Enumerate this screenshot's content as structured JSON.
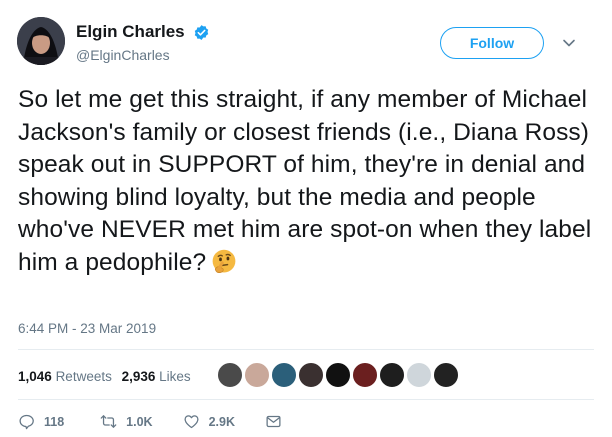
{
  "user": {
    "display_name": "Elgin Charles",
    "handle": "@ElginCharles",
    "verified": true
  },
  "follow_button": {
    "label": "Follow"
  },
  "tweet": {
    "text": "So let me get this straight, if any member of Michael Jackson's family or closest friends (i.e., Diana Ross) speak out in SUPPORT of him, they're in denial and showing blind loyalty, but the media and people who've NEVER met him are spot-on when they label him a pedophile?",
    "emoji": "thinking-face",
    "timestamp": "6:44 PM - 23 Mar 2019"
  },
  "stats": {
    "retweets_count": "1,046",
    "retweets_label": "Retweets",
    "likes_count": "2,936",
    "likes_label": "Likes"
  },
  "likers": [
    {
      "color": "#4a4a4a"
    },
    {
      "color": "#c9a89a"
    },
    {
      "color": "#2b5f7a"
    },
    {
      "color": "#3a3030"
    },
    {
      "color": "#111111"
    },
    {
      "color": "#6b1f1f"
    },
    {
      "color": "#1e1e1e"
    },
    {
      "color": "#cfd6db"
    },
    {
      "color": "#222222"
    }
  ],
  "actions": {
    "reply_count": "118",
    "retweet_count": "1.0K",
    "like_count": "2.9K"
  },
  "colors": {
    "accent": "#1da1f2",
    "secondary_text": "#657786",
    "primary_text": "#14171a",
    "divider": "#e6ecf0"
  }
}
